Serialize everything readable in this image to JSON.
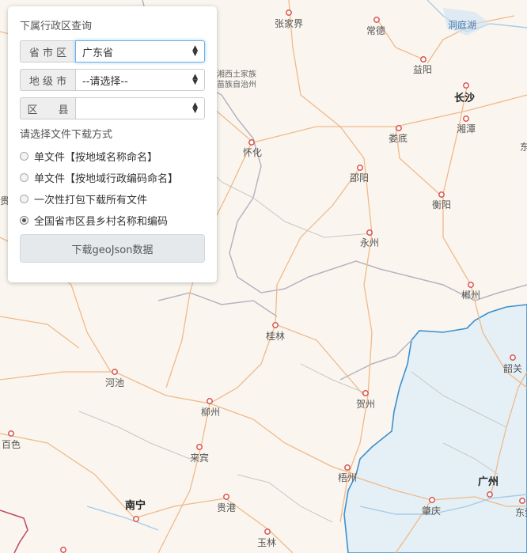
{
  "map": {
    "cities": [
      {
        "name": "张家界",
        "major": false
      },
      {
        "name": "常德",
        "major": false
      },
      {
        "name": "益阳",
        "major": false
      },
      {
        "name": "长沙",
        "major": true
      },
      {
        "name": "湘潭",
        "major": false
      },
      {
        "name": "娄底",
        "major": false
      },
      {
        "name": "怀化",
        "major": false
      },
      {
        "name": "邵阳",
        "major": false
      },
      {
        "name": "衡阳",
        "major": false
      },
      {
        "name": "永州",
        "major": false
      },
      {
        "name": "郴州",
        "major": false
      },
      {
        "name": "桂林",
        "major": false
      },
      {
        "name": "河池",
        "major": false
      },
      {
        "name": "贺州",
        "major": false
      },
      {
        "name": "韶关",
        "major": false
      },
      {
        "name": "柳州",
        "major": false
      },
      {
        "name": "百色",
        "major": false
      },
      {
        "name": "来宾",
        "major": false
      },
      {
        "name": "梧州",
        "major": false
      },
      {
        "name": "南宁",
        "major": true
      },
      {
        "name": "贵港",
        "major": false
      },
      {
        "name": "肇庆",
        "major": false
      },
      {
        "name": "广州",
        "major": true
      },
      {
        "name": "玉林",
        "major": false
      }
    ],
    "water_labels": [
      "洞庭湖"
    ],
    "region_label_line1": "湘西土家族",
    "region_label_line2": "苗族自治州",
    "edge_label_left": "贵",
    "edge_label_right": "东莞"
  },
  "panel": {
    "title": "下属行政区查询",
    "province_label": "省 市 区",
    "province_value": "广东省",
    "city_label": "地 级 市",
    "city_value": "--请选择--",
    "county_label": "区　　县",
    "county_value": "",
    "download_mode_label": "请选择文件下载方式",
    "options": [
      {
        "label": "单文件【按地域名称命名】",
        "checked": false
      },
      {
        "label": "单文件【按地域行政编码命名】",
        "checked": false
      },
      {
        "label": "一次性打包下载所有文件",
        "checked": false
      },
      {
        "label": "全国省市区县乡村名称和编码",
        "checked": true
      }
    ],
    "download_button": "下载geoJson数据"
  }
}
